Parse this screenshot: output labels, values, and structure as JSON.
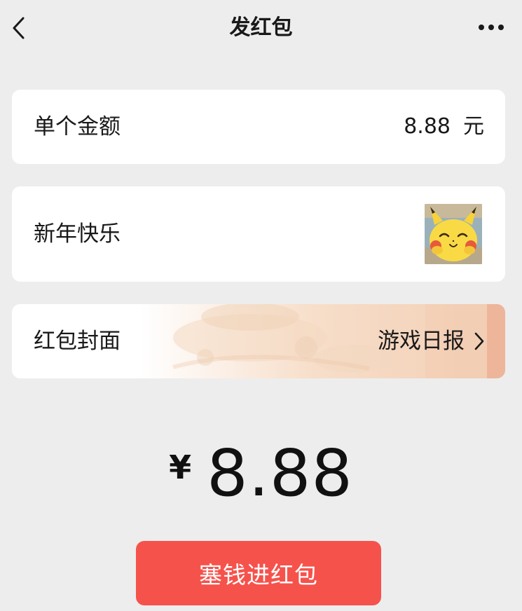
{
  "header": {
    "title": "发红包"
  },
  "amount": {
    "label": "单个金额",
    "value": "8.88",
    "unit": "元"
  },
  "greeting": {
    "text": "新年快乐"
  },
  "cover": {
    "label": "红包封面",
    "value": "游戏日报"
  },
  "total": {
    "currency": "¥",
    "value": "8.88"
  },
  "submit": {
    "label": "塞钱进红包"
  },
  "colors": {
    "background": "#ededed",
    "card": "#ffffff",
    "submit_button": "#f6524c"
  }
}
